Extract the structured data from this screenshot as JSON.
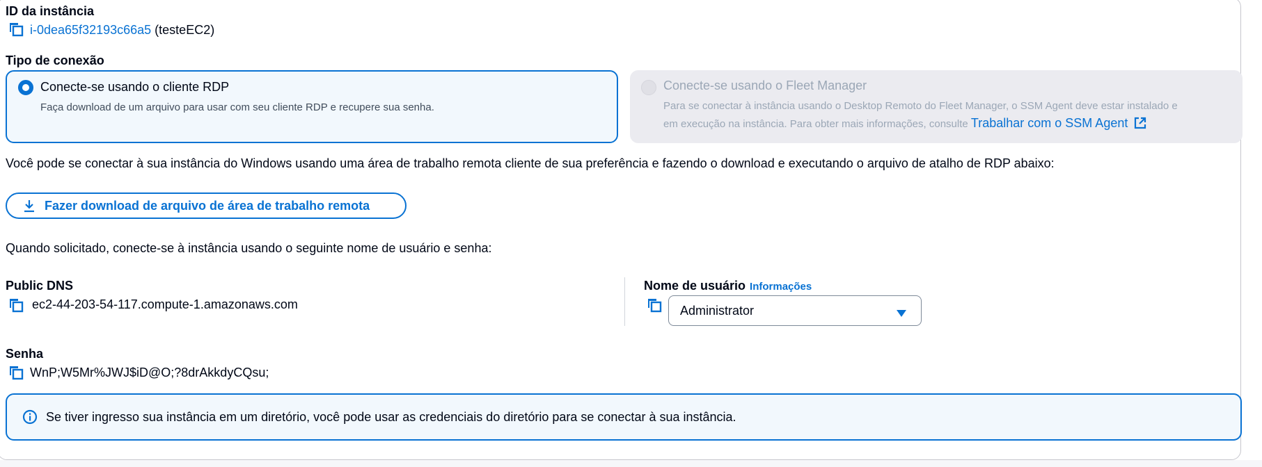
{
  "instance": {
    "id_label": "ID da instância",
    "id_value": "i-0dea65f32193c66a5",
    "name_suffix": "(testeEC2)"
  },
  "connection": {
    "label": "Tipo de conexão",
    "rdp": {
      "title": "Conecte-se usando o cliente RDP",
      "description": "Faça download de um arquivo para usar com seu cliente RDP e recupere sua senha.",
      "selected": true
    },
    "fleet": {
      "title": "Conecte-se usando o Fleet Manager",
      "description_line1": "Para se conectar à instância usando o Desktop Remoto do Fleet Manager, o SSM Agent deve estar instalado e",
      "description_line2": "em execução na instância. Para obter mais informações, consulte",
      "link_text": "Trabalhar com o SSM Agent",
      "disabled": true
    }
  },
  "instructions": {
    "rdp_text": "Você pode se conectar à sua instância do Windows usando uma área de trabalho remota cliente de sua preferência e fazendo o download e executando o arquivo de atalho de RDP abaixo:",
    "download_button": "Fazer download de arquivo de área de trabalho remota",
    "credentials_text": "Quando solicitado, conecte-se à instância usando o seguinte nome de usuário e senha:"
  },
  "public_dns": {
    "label": "Public DNS",
    "value": "ec2-44-203-54-117.compute-1.amazonaws.com"
  },
  "username": {
    "label": "Nome de usuário",
    "info_link": "Informações",
    "selected": "Administrator"
  },
  "password": {
    "label": "Senha",
    "value": "WnP;W5Mr%JWJ$iD@O;?8drAkkdyCQsu;"
  },
  "alert": {
    "text": "Se tiver ingresso sua instância em um diretório, você pode usar as credenciais do diretório para se conectar à sua instância."
  },
  "colors": {
    "accent": "#0972d3",
    "tile_selected_bg": "#f2f8fd",
    "tile_disabled_bg": "#ebebf0",
    "disabled_text": "#9ba7b6"
  },
  "icons": {
    "copy": "copy-icon",
    "download": "download-icon",
    "external": "external-link-icon",
    "info": "info-icon",
    "caret": "caret-down-icon"
  }
}
